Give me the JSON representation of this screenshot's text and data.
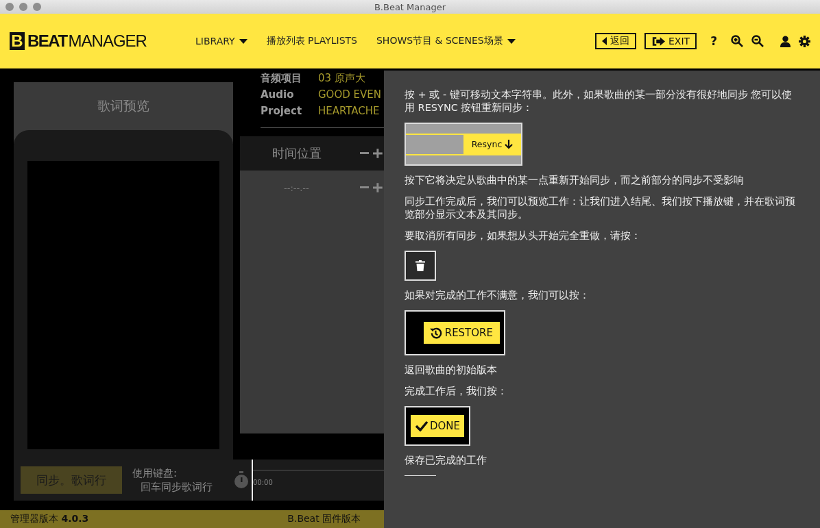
{
  "window": {
    "title": "B.Beat Manager"
  },
  "header": {
    "logo": {
      "mark": "B",
      "bold": "BEAT",
      "light": "MANAGER"
    },
    "nav": [
      {
        "label": "LIBRARY",
        "dropdown": true
      },
      {
        "label": "播放列表 PLAYLISTS",
        "dropdown": false
      },
      {
        "label": "SHOWS节目 & SCENES场景",
        "dropdown": true
      }
    ],
    "back_button": "返回",
    "exit_button": "EXIT",
    "help": "?"
  },
  "lyrics_preview": {
    "title": "歌词预览"
  },
  "project": {
    "label": "音频项目 Audio Project",
    "values": [
      "03 原声大",
      "GOOD EVEN",
      "HEARTACHE"
    ]
  },
  "time_panel": {
    "title": "时间位置",
    "time": "--:--.--"
  },
  "sync_button": "同步。歌词行",
  "keyboard_hint": [
    "使用键盘:",
    "回车同步歌词行"
  ],
  "timeline": {
    "time": "00:00"
  },
  "status_bar": {
    "version": "管理器版本 **4.0.3**",
    "firmware": "B.Beat 固件版本"
  },
  "help_panel": [
    {
      "kind": "text",
      "text": "按 + 或 - 键可移动文本字符串。此外，如果歌曲的某一部分没有很好地同步 您可以使用 RESYNC 按钮重新同步："
    },
    {
      "kind": "resync",
      "label": "Resync"
    },
    {
      "kind": "text",
      "text": "按下它将决定从歌曲中的某一点重新开始同步，而之前部分的同步不受影响"
    },
    {
      "kind": "text",
      "text": "同步工作完成后，我们可以预览工作：让我们进入结尾、我们按下播放键，并在歌词预览部分显示文本及其同步。"
    },
    {
      "kind": "text",
      "text": "要取消所有同步，如果想从头开始完全重做，请按："
    },
    {
      "kind": "trash"
    },
    {
      "kind": "text",
      "text": "如果对完成的工作不满意，我们可以按："
    },
    {
      "kind": "restore",
      "label": "RESTORE"
    },
    {
      "kind": "text",
      "text": "返回歌曲的初始版本"
    },
    {
      "kind": "text",
      "text": "完成工作后，我们按："
    },
    {
      "kind": "done",
      "label": "DONE"
    },
    {
      "kind": "text",
      "text": "保存已完成的工作"
    },
    {
      "kind": "rule"
    }
  ]
}
